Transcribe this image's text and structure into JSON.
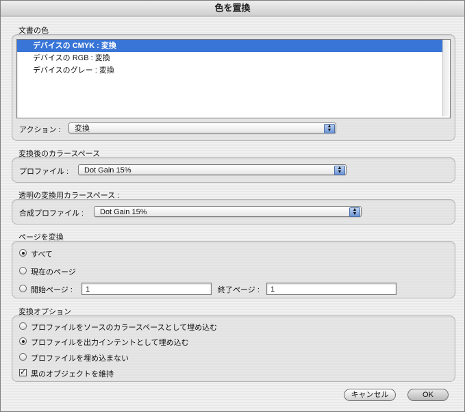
{
  "window": {
    "title": "色を置換"
  },
  "doc_colors": {
    "label": "文書の色",
    "items": [
      {
        "label": "デバイスの CMYK : 変換",
        "selected": true
      },
      {
        "label": "デバイスの RGB : 変換",
        "selected": false
      },
      {
        "label": "デバイスのグレー : 変換",
        "selected": false
      }
    ],
    "action_label": "アクション :",
    "action_value": "変換"
  },
  "dest_space": {
    "label": "変換後のカラースペース",
    "profile_label": "プロファイル :",
    "profile_value": "Dot Gain 15%"
  },
  "blend_space": {
    "label": "透明の変換用カラースペース :",
    "profile_label": "合成プロファイル :",
    "profile_value": "Dot Gain 15%"
  },
  "pages": {
    "label": "ページを変換",
    "all": "すべて",
    "current": "現在のページ",
    "from_label": "開始ページ :",
    "from_value": "1",
    "to_label": "終了ページ :",
    "to_value": "1",
    "selected": "all"
  },
  "options": {
    "label": "変換オプション",
    "embed_source": "プロファイルをソースのカラースペースとして埋め込む",
    "embed_output": "プロファイルを出力インテントとして埋め込む",
    "no_embed": "プロファイルを埋め込まない",
    "preserve_black": "黒のオブジェクトを維持",
    "selected": "embed_output",
    "preserve_black_checked": true
  },
  "buttons": {
    "cancel": "キャンセル",
    "ok": "OK"
  },
  "icons": {
    "popup_arrows": "up-down-arrows-icon",
    "check": "checkmark-icon"
  }
}
